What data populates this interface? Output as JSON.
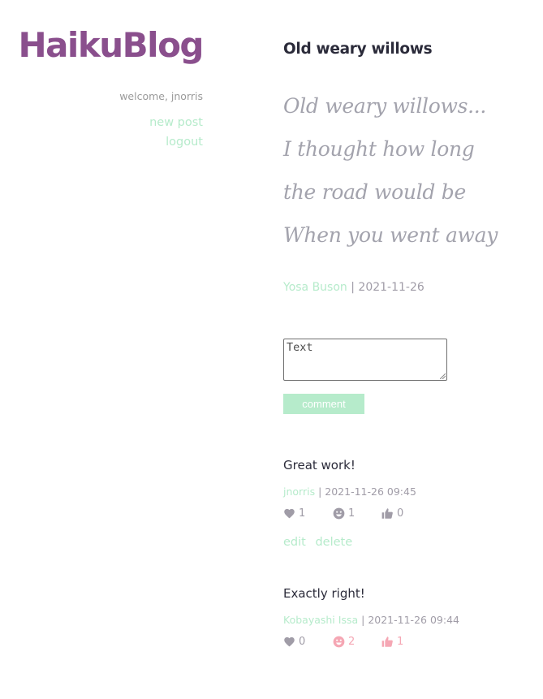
{
  "app": {
    "logo": "HaikuBlog"
  },
  "sidebar": {
    "welcome": "welcome, jnorris",
    "new_post": "new post",
    "logout": "logout"
  },
  "post": {
    "title": "Old weary willows",
    "lines": [
      "Old weary willows...",
      "I thought how long",
      "the road would be",
      "When you went away"
    ],
    "author": "Yosa Buson",
    "separator": "|",
    "date": "2021-11-26"
  },
  "comment_form": {
    "placeholder": "Text",
    "button_label": "comment"
  },
  "comments": [
    {
      "text": "Great work!",
      "author": "jnorris",
      "timestamp": "2021-11-26 09:45",
      "reactions": {
        "heart": "1",
        "smile": "1",
        "thumbs": "0"
      },
      "active": {
        "heart": false,
        "smile": false,
        "thumbs": false
      },
      "edit_label": "edit",
      "delete_label": "delete"
    },
    {
      "text": "Exactly right!",
      "author": "Kobayashi Issa",
      "timestamp": "2021-11-26 09:44",
      "reactions": {
        "heart": "0",
        "smile": "2",
        "thumbs": "1"
      },
      "active": {
        "heart": false,
        "smile": true,
        "thumbs": true
      }
    }
  ],
  "colors": {
    "brand": "#8a4f8d",
    "accent_green": "#b6ebcb",
    "muted_gray": "#a09ca7",
    "reaction_active": "#f5a7b4"
  },
  "icons": {
    "heart": "heart-icon",
    "smile": "smile-icon",
    "thumbs": "thumbs-up-icon"
  }
}
